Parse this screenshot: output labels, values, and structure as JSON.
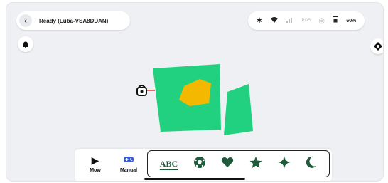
{
  "status_bar": {
    "back_icon": "chevron-left-icon",
    "status_text": "Ready  (Luba-VSA8DDAN)",
    "rtk_label": "POS",
    "battery_text": "60%",
    "battery_level": 60
  },
  "map": {
    "zone_color": "#22d17f",
    "obstacle_color": "#f5b800"
  },
  "modes": [
    {
      "label": "Mow",
      "icon": "play-icon"
    },
    {
      "label": "Manual",
      "icon": "gamepad-icon"
    }
  ],
  "shapes": {
    "abc_label": "ABC",
    "items": [
      "text-pattern-icon",
      "soccer-ball-icon",
      "heart-icon",
      "star-icon",
      "sparkle-icon",
      "crescent-moon-icon"
    ]
  }
}
